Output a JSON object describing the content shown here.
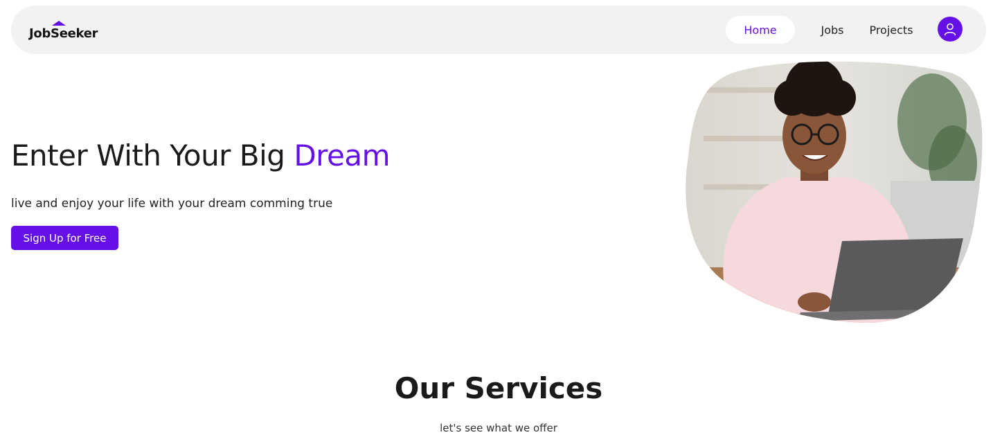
{
  "brand": {
    "logo_text": "JobSeeker",
    "accent_color": "#6610e8"
  },
  "nav": {
    "items": [
      {
        "label": "Home",
        "active": true
      },
      {
        "label": "Jobs",
        "active": false
      },
      {
        "label": "Projects",
        "active": false
      }
    ],
    "avatar_icon": "user-icon"
  },
  "hero": {
    "title_main": "Enter With Your Big ",
    "title_accent": "Dream",
    "subtitle": "live and enjoy your life with your dream comming true",
    "cta_label": "Sign Up for Free",
    "image_icon": "person-with-laptop-photo"
  },
  "services": {
    "title": "Our Services",
    "subtitle": "let's see what we offer"
  }
}
